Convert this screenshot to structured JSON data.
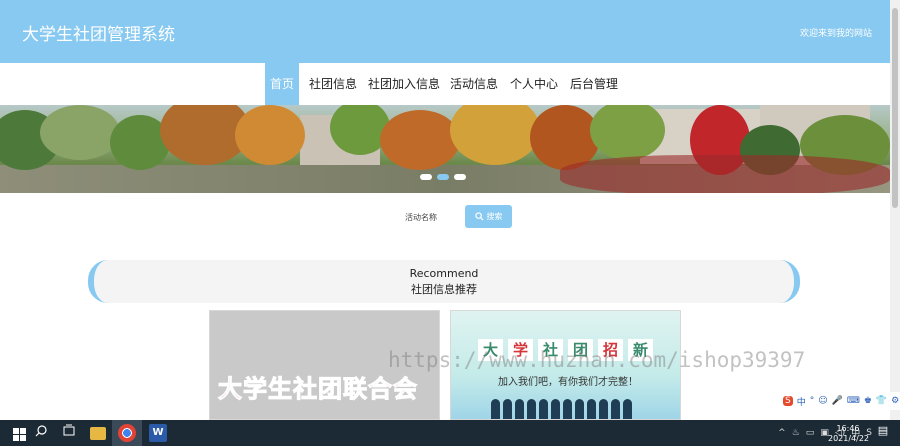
{
  "header": {
    "site_title": "大学生社团管理系统",
    "welcome": "欢迎来到我的网站"
  },
  "nav": {
    "items": [
      {
        "label": "首页",
        "active": true
      },
      {
        "label": "社团信息"
      },
      {
        "label": "社团加入信息"
      },
      {
        "label": "活动信息"
      },
      {
        "label": "个人中心"
      },
      {
        "label": "后台管理"
      }
    ]
  },
  "search": {
    "label": "活动名称",
    "button_label": "搜索"
  },
  "recommend": {
    "title_en": "Recommend",
    "title_cn": "社团信息推荐"
  },
  "cards": {
    "card1_text": "大学生社团联合会",
    "card2_tiles": [
      "大",
      "学",
      "社",
      "团",
      "招",
      "新"
    ],
    "card2_sub": "加入我们吧，有你我们才完整！"
  },
  "watermark": "https://www.huzhan.com/ishop39397",
  "ime": {
    "items": [
      "S",
      "中",
      "°",
      "☺",
      "🎤",
      "⌨",
      "♚",
      "👕",
      "⚙"
    ]
  },
  "taskbar": {
    "clock_time": "16:46",
    "clock_date": "2021/4/22",
    "tray_input": "中"
  },
  "colors": {
    "accent": "#87c9f0",
    "taskbar": "#1c2a36"
  }
}
